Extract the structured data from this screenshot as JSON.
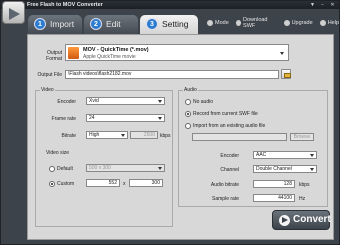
{
  "window": {
    "title": "Free Flash to MOV Converter",
    "controls": [
      "▼",
      "−",
      "✕"
    ]
  },
  "tabs": [
    {
      "num": "1",
      "label": "Import"
    },
    {
      "num": "2",
      "label": "Edit"
    },
    {
      "num": "3",
      "label": "Setting"
    }
  ],
  "menu": [
    {
      "label": "Mode",
      "icon": "mode-icon"
    },
    {
      "label": "Download SWF",
      "icon": "download-icon"
    },
    {
      "label": "Upgrade",
      "icon": "upgrade-icon"
    },
    {
      "label": "Help",
      "icon": "help-icon"
    }
  ],
  "output": {
    "format_label": "Output Format",
    "format_name": "MOV - QuickTime (*.mov)",
    "format_desc": "Apple QuickTime movie",
    "file_label": "Output File",
    "file_value": "\\Flash videos\\flash2182.mov"
  },
  "video": {
    "title": "Video",
    "encoder_label": "Encoder",
    "encoder": "Xvid",
    "framerate_label": "Frame rate",
    "framerate": "24",
    "bitrate_label": "Bitrate",
    "bitrate": "High",
    "bitrate_value": "2500",
    "bitrate_unit": "kbps",
    "size_label": "Video size",
    "default_label": "Default",
    "default_size": "500 x 300",
    "custom_label": "Custom",
    "custom_w": "552",
    "custom_x": "x",
    "custom_h": "300"
  },
  "audio": {
    "title": "Audio",
    "opt1": "No audio",
    "opt2": "Record from current SWF file",
    "opt3": "Import from an existing audio file",
    "browse": "Browse",
    "encoder_label": "Encoder",
    "encoder": "AAC",
    "channel_label": "Channel",
    "channel": "Double Channel",
    "bitrate_label": "Audio bitrate",
    "bitrate": "128",
    "bitrate_unit": "kbps",
    "samplerate_label": "Sample rate",
    "samplerate": "44100",
    "samplerate_unit": "Hz"
  },
  "convert_label": "Convert"
}
